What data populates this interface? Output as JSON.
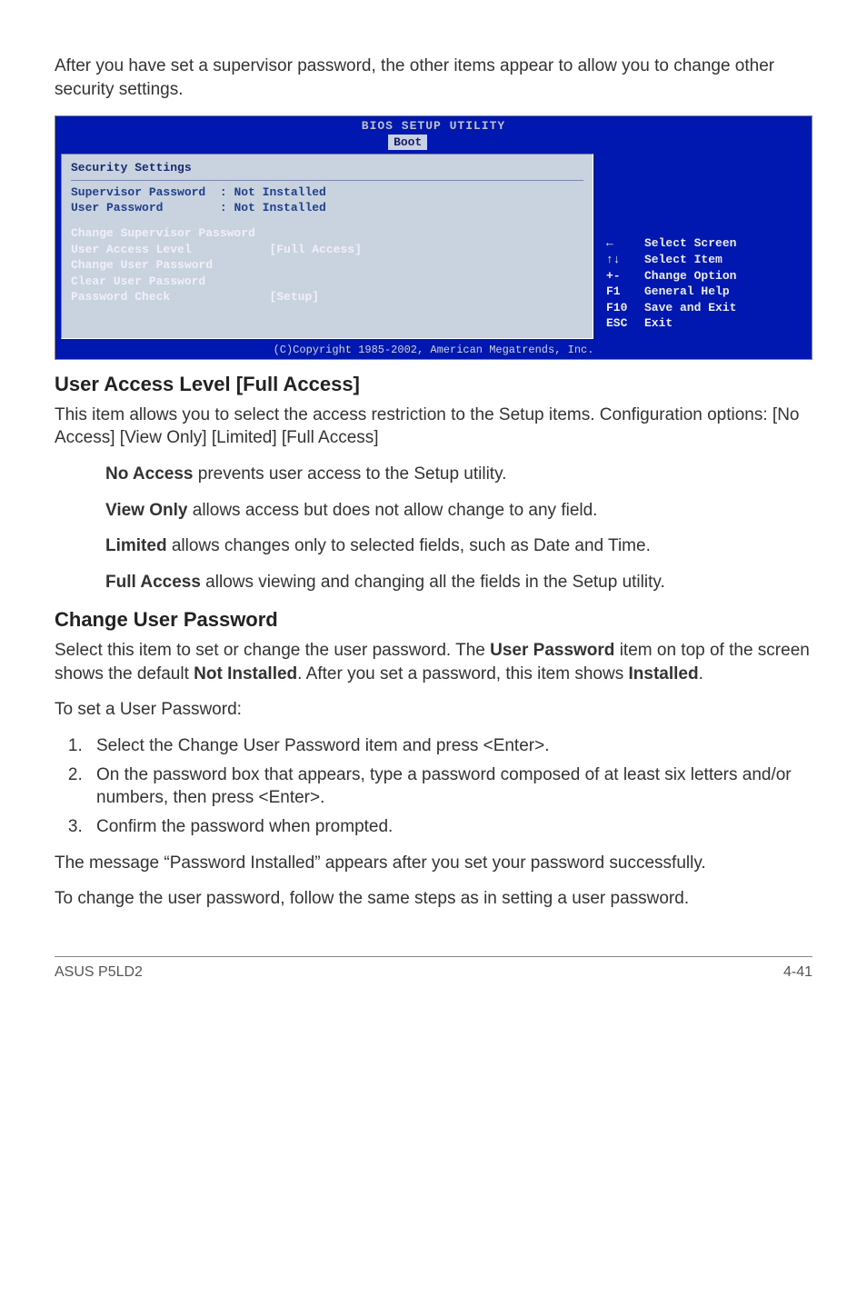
{
  "intro": "After you have set a supervisor password, the other items appear to allow you to change other security settings.",
  "bios": {
    "title": "BIOS SETUP UTILITY",
    "tab": "Boot",
    "heading": "Security Settings",
    "rows": {
      "sup_label": "Supervisor Password",
      "sup_val": ": Not Installed",
      "usr_label": "User Password",
      "usr_val": ": Not Installed",
      "change_sup": "Change Supervisor Password",
      "ual_label": "User Access Level",
      "ual_val": "[Full Access]",
      "change_usr": "Change User Password",
      "clear_usr": "Clear User Password",
      "pwcheck_label": "Password Check",
      "pwcheck_val": "[Setup]"
    },
    "help": {
      "l1k": "←",
      "l1v": "Select Screen",
      "l2k": "↑↓",
      "l2v": "Select Item",
      "l3k": "+-",
      "l3v": "Change Option",
      "l4k": "F1",
      "l4v": "General Help",
      "l5k": "F10",
      "l5v": "Save and Exit",
      "l6k": "ESC",
      "l6v": "Exit"
    },
    "footer": "(C)Copyright 1985-2002, American Megatrends, Inc."
  },
  "sec_ual": {
    "title": "User Access Level [Full Access]",
    "body": "This item allows you to select the access restriction to the Setup items. Configuration options: [No Access] [View Only] [Limited] [Full Access]",
    "opts": {
      "no_b": "No Access",
      "no_t": " prevents user access to the Setup utility.",
      "vo_b": "View Only",
      "vo_t": " allows access but does not allow change to any field.",
      "li_b": "Limited",
      "li_t": " allows changes only to selected fields, such as Date and Time.",
      "fa_b": "Full Access",
      "fa_t": " allows viewing and changing all the fields in the Setup utility."
    }
  },
  "sec_cup": {
    "title": "Change User Password",
    "p1a": "Select this item to set or change the user password. The ",
    "p1b": "User Password",
    "p1c": " item on top of the screen shows the default ",
    "p1d": "Not Installed",
    "p1e": ". After you set a password, this item shows ",
    "p1f": "Installed",
    "p1g": ".",
    "p2": "To set a User Password:",
    "steps": {
      "s1": "Select the Change User Password item and press <Enter>.",
      "s2": "On the password box that appears, type a password composed of at least six letters and/or numbers, then press <Enter>.",
      "s3": "Confirm the password when prompted."
    },
    "p3": "The message “Password Installed” appears after you set your password successfully.",
    "p4": "To change the user password, follow the same steps as in setting a user password."
  },
  "footer": {
    "left": "ASUS P5LD2",
    "right": "4-41"
  }
}
